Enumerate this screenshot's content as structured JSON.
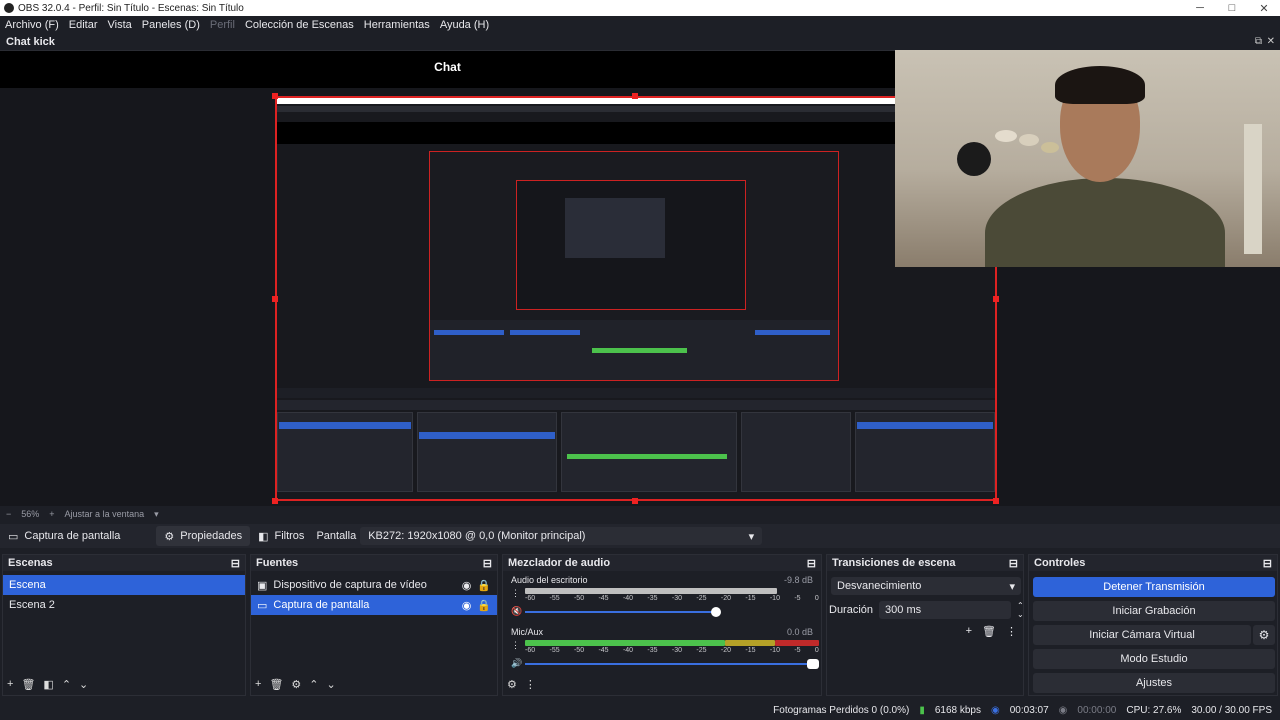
{
  "window": {
    "title": "OBS 32.0.4 - Perfil: Sin Título - Escenas: Sin Título"
  },
  "menu": [
    "Archivo (F)",
    "Editar",
    "Vista",
    "Paneles (D)",
    "Perfil",
    "Colección de Escenas",
    "Herramientas",
    "Ayuda (H)"
  ],
  "dock_title": "Chat kick",
  "chat": {
    "title": "Chat"
  },
  "zoom": {
    "level": "56%",
    "fit_label": "Ajustar a la ventana"
  },
  "source_toolbar": {
    "source_name": "Captura de pantalla",
    "properties": "Propiedades",
    "filters": "Filtros",
    "display_label": "Pantalla",
    "display_value": "KB272: 1920x1080 @ 0,0 (Monitor principal)"
  },
  "scenes": {
    "title": "Escenas",
    "items": [
      "Escena",
      "Escena 2"
    ]
  },
  "sources": {
    "title": "Fuentes",
    "items": [
      "Dispositivo de captura de vídeo",
      "Captura de pantalla"
    ]
  },
  "mixer": {
    "title": "Mezclador de audio",
    "channels": [
      {
        "name": "Audio del escritorio",
        "db": "-9.8 dB"
      },
      {
        "name": "Mic/Aux",
        "db": "0.0 dB"
      }
    ],
    "ticks": [
      "-60",
      "-55",
      "-50",
      "-45",
      "-40",
      "-35",
      "-30",
      "-25",
      "-20",
      "-15",
      "-10",
      "-5",
      "0"
    ]
  },
  "transitions": {
    "title": "Transiciones de escena",
    "selected": "Desvanecimiento",
    "duration_label": "Duración",
    "duration_value": "300 ms"
  },
  "controls": {
    "title": "Controles",
    "stop_stream": "Detener Transmisión",
    "start_record": "Iniciar Grabación",
    "start_virtualcam": "Iniciar Cámara Virtual",
    "studio_mode": "Modo Estudio",
    "settings": "Ajustes"
  },
  "status": {
    "dropped": "Fotogramas Perdidos 0 (0.0%)",
    "bitrate": "6168 kbps",
    "stream_time": "00:03:07",
    "rec_time": "00:00:00",
    "cpu": "CPU: 27.6%",
    "fps": "30.00 / 30.00 FPS"
  },
  "colors": {
    "accent": "#2e63d9",
    "meter_green": "#4cc24c",
    "meter_yellow": "#b5a127",
    "meter_red": "#c02a2a",
    "selection_red": "#dd2222"
  }
}
